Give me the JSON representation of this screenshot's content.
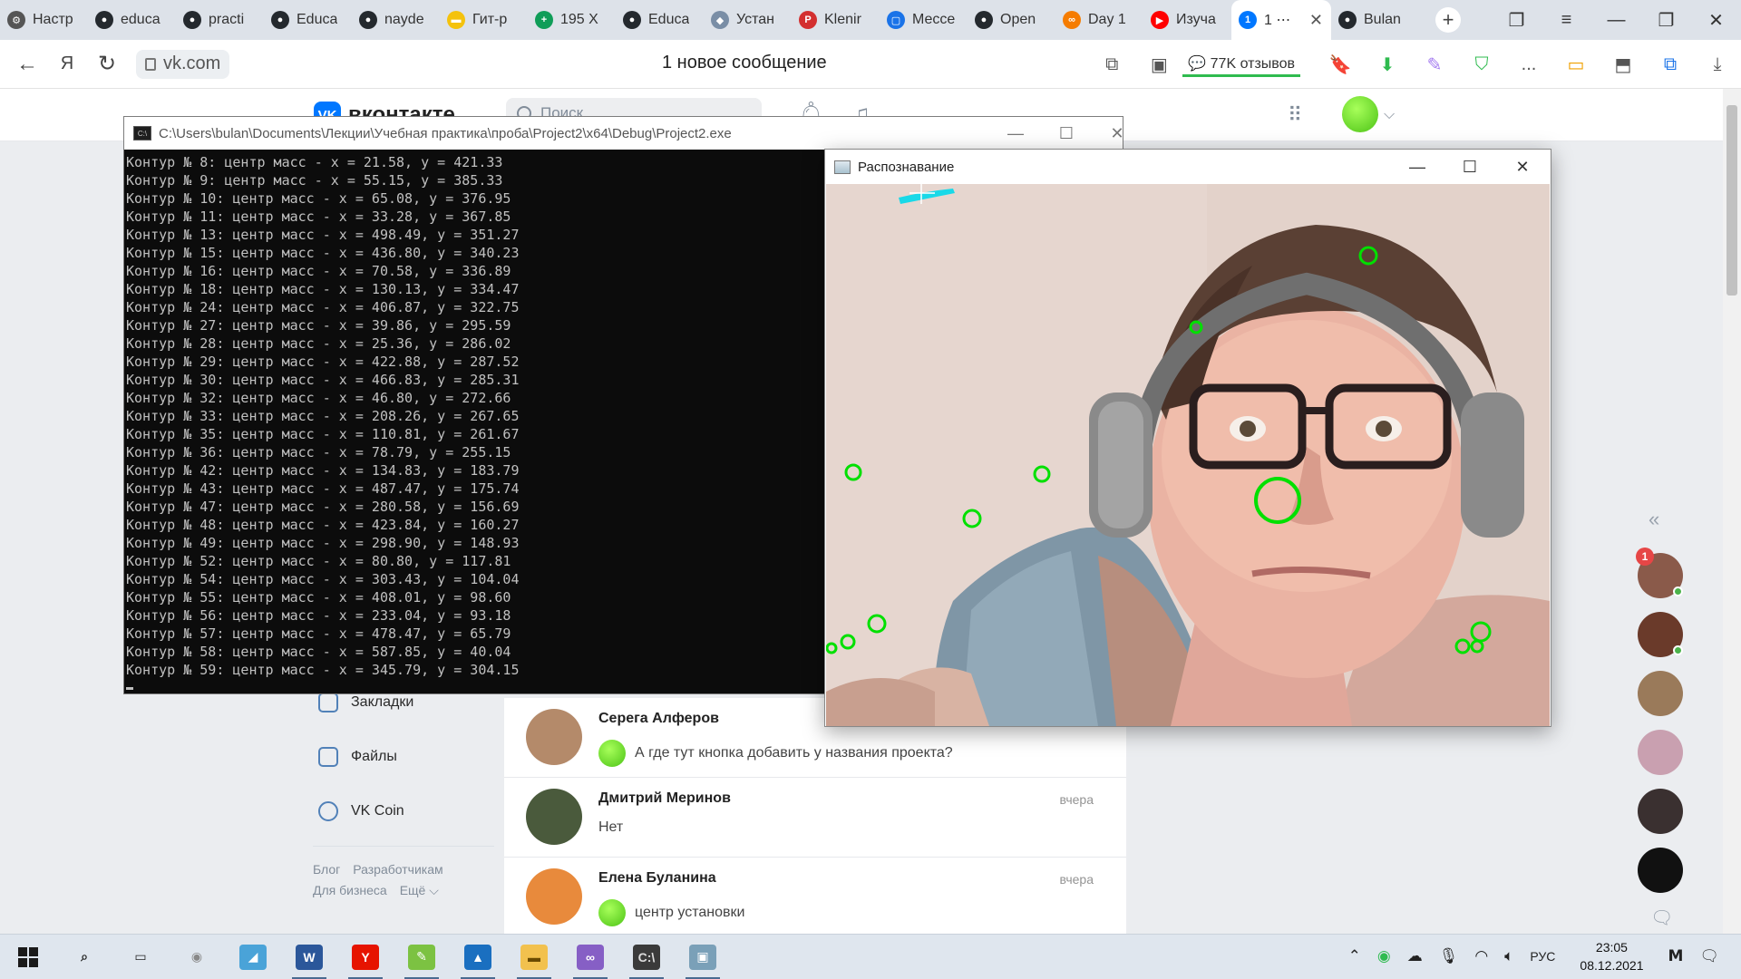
{
  "browser": {
    "tabs": [
      {
        "label": "Настр",
        "color": "#555555",
        "glyph": "⚙"
      },
      {
        "label": "educa",
        "color": "#24292e",
        "glyph": "●"
      },
      {
        "label": "practi",
        "color": "#24292e",
        "glyph": "●"
      },
      {
        "label": "Educa",
        "color": "#24292e",
        "glyph": "●"
      },
      {
        "label": "nayde",
        "color": "#24292e",
        "glyph": "●"
      },
      {
        "label": "Гит-р",
        "color": "#f4c20d",
        "glyph": "▬"
      },
      {
        "label": "195 Х",
        "color": "#0f9d58",
        "glyph": "+"
      },
      {
        "label": "Educa",
        "color": "#24292e",
        "glyph": "●"
      },
      {
        "label": "Устан",
        "color": "#7a8ea6",
        "glyph": "◆"
      },
      {
        "label": "Klenir",
        "color": "#d32f2f",
        "glyph": "P"
      },
      {
        "label": "Мессе",
        "color": "#1a73e8",
        "glyph": "▢"
      },
      {
        "label": "Open",
        "color": "#24292e",
        "glyph": "●"
      },
      {
        "label": "Day 1",
        "color": "#f57c00",
        "glyph": "∞"
      },
      {
        "label": "Изуча",
        "color": "#ff0000",
        "glyph": "▶"
      },
      {
        "label": "1 ⋯",
        "color": "#0077ff",
        "glyph": "1"
      },
      {
        "label": "Bulan",
        "color": "#24292e",
        "glyph": "●"
      }
    ],
    "active_tab_close": "✕",
    "new_tab": "+",
    "url": "vk.com",
    "page_title": "1 новое сообщение",
    "reviews": "77K отзывов",
    "more": "..."
  },
  "vk": {
    "logo_mark": "VK",
    "logo_text": "вконтакте",
    "search_placeholder": "Поиск",
    "menu": [
      {
        "label": "Закладки"
      },
      {
        "label": "Файлы"
      },
      {
        "label": "VK Coin"
      }
    ],
    "footer_links": [
      "Блог",
      "Разработчикам",
      "Для бизнеса",
      "Ещё ⌵"
    ],
    "messages": [
      {
        "name": "Серега Алферов",
        "time": "",
        "text": "А где тут кнопка добавить у названия проекта?",
        "avatar_color": "#b48a6a",
        "has_smile": true
      },
      {
        "name": "Дмитрий Меринов",
        "time": "вчера",
        "text": "Нет",
        "avatar_color": "#4a5a3c",
        "has_smile": false
      },
      {
        "name": "Елена Буланина",
        "time": "вчера",
        "text": "центр установки",
        "avatar_color": "#e88a3c",
        "has_smile": true
      }
    ],
    "rail_collapse": "«",
    "rail_badge": "1",
    "rail_avatars": [
      "#8a5a4a",
      "#6a3a2a",
      "#9a7a5a",
      "#c9a0b0",
      "#3a3030",
      "#111111"
    ]
  },
  "console": {
    "title": "C:\\Users\\bulan\\Documents\\Лекции\\Учебная практика\\проба\\Project2\\x64\\Debug\\Project2.exe",
    "icon_label": "C:\\",
    "lines": [
      "Контур № 8: центр масс - x = 21.58, y = 421.33",
      "Контур № 9: центр масс - x = 55.15, y = 385.33",
      "Контур № 10: центр масс - x = 65.08, y = 376.95",
      "Контур № 11: центр масс - x = 33.28, y = 367.85",
      "Контур № 13: центр масс - x = 498.49, y = 351.27",
      "Контур № 15: центр масс - x = 436.80, y = 340.23",
      "Контур № 16: центр масс - x = 70.58, y = 336.89",
      "Контур № 18: центр масс - x = 130.13, y = 334.47",
      "Контур № 24: центр масс - x = 406.87, y = 322.75",
      "Контур № 27: центр масс - x = 39.86, y = 295.59",
      "Контур № 28: центр масс - x = 25.36, y = 286.02",
      "Контур № 29: центр масс - x = 422.88, y = 287.52",
      "Контур № 30: центр масс - x = 466.83, y = 285.31",
      "Контур № 32: центр масс - x = 46.80, y = 272.66",
      "Контур № 33: центр масс - x = 208.26, y = 267.65",
      "Контур № 35: центр масс - x = 110.81, y = 261.67",
      "Контур № 36: центр масс - x = 78.79, y = 255.15",
      "Контур № 42: центр масс - x = 134.83, y = 183.79",
      "Контур № 43: центр масс - x = 487.47, y = 175.74",
      "Контур № 47: центр масс - x = 280.58, y = 156.69",
      "Контур № 48: центр масс - x = 423.84, y = 160.27",
      "Контур № 49: центр масс - x = 298.90, y = 148.93",
      "Контур № 52: центр масс - x = 80.80, y = 117.81",
      "Контур № 54: центр масс - x = 303.43, y = 104.04",
      "Контур № 55: центр масс - x = 408.01, y = 98.60",
      "Контур № 56: центр масс - x = 233.04, y = 93.18",
      "Контур № 57: центр масс - x = 478.47, y = 65.79",
      "Контур № 58: центр масс - x = 587.85, y = 40.04",
      "Контур № 59: центр масс - x = 345.79, y = 304.15"
    ]
  },
  "recognition": {
    "title": "Распознавание",
    "marker_color": "#00e000"
  },
  "taskbar": {
    "language": "РУС",
    "time": "23:05",
    "date": "08.12.2021",
    "apps": [
      {
        "name": "search",
        "glyph": "⌕",
        "color": "transparent",
        "fg": "#222"
      },
      {
        "name": "task-view",
        "glyph": "▭",
        "color": "transparent",
        "fg": "#222"
      },
      {
        "name": "disc",
        "glyph": "◉",
        "color": "transparent",
        "fg": "#888"
      },
      {
        "name": "app-blue",
        "glyph": "◢",
        "color": "#4aa3d8",
        "fg": "#fff"
      },
      {
        "name": "word",
        "glyph": "W",
        "color": "#2b579a",
        "fg": "#fff"
      },
      {
        "name": "yandex",
        "glyph": "Y",
        "color": "#e61400",
        "fg": "#fff"
      },
      {
        "name": "tools",
        "glyph": "✎",
        "color": "#7cc242",
        "fg": "#fff"
      },
      {
        "name": "photos",
        "glyph": "▲",
        "color": "#1a6fc0",
        "fg": "#fff"
      },
      {
        "name": "explorer",
        "glyph": "▬",
        "color": "#f2c14e",
        "fg": "#6a4a00"
      },
      {
        "name": "visual-studio",
        "glyph": "∞",
        "color": "#865fc5",
        "fg": "#fff"
      },
      {
        "name": "console",
        "glyph": "C:\\",
        "color": "#3a3a3a",
        "fg": "#ddd"
      },
      {
        "name": "recognition-app",
        "glyph": "▣",
        "color": "#7aa0b8",
        "fg": "#fff"
      }
    ]
  }
}
